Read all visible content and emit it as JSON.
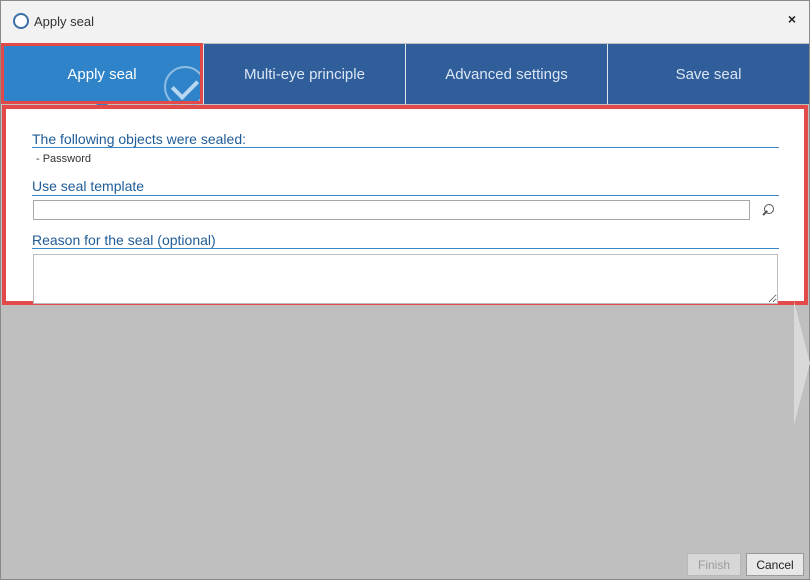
{
  "window": {
    "title": "Apply seal",
    "close_glyph": "×"
  },
  "tabs": [
    {
      "label": "Apply seal",
      "active": true
    },
    {
      "label": "Multi-eye principle",
      "active": false
    },
    {
      "label": "Advanced settings",
      "active": false
    },
    {
      "label": "Save seal",
      "active": false
    }
  ],
  "content": {
    "objects_title": "The following objects were sealed:",
    "objects": [
      "- Password"
    ],
    "template_title": "Use seal template",
    "template_value": "",
    "reason_title": "Reason for the seal (optional)",
    "reason_value": ""
  },
  "buttons": {
    "finish": "Finish",
    "cancel": "Cancel"
  },
  "colors": {
    "accent": "#2f83c8",
    "tab_bg": "#2f5e9b",
    "highlight": "#e24a4a"
  },
  "icons": {
    "app": "seal-icon",
    "close": "close-icon",
    "search": "search-icon",
    "check": "check-icon"
  }
}
